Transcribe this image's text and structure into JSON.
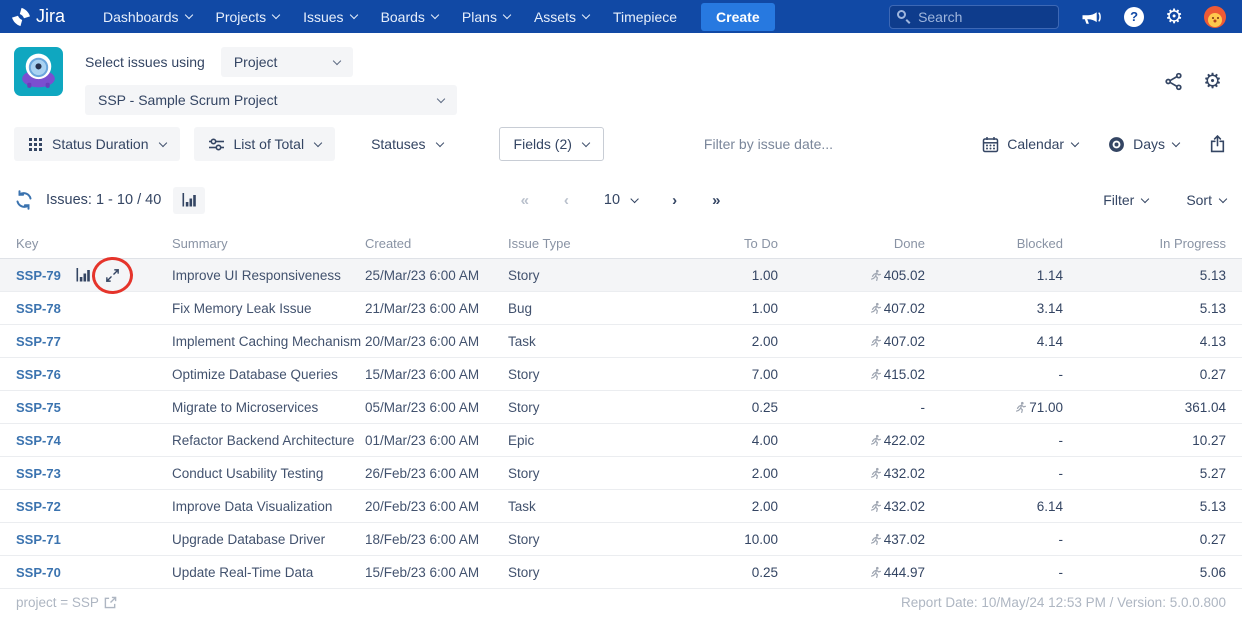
{
  "colors": {
    "nav_bg": "#1149A5",
    "create_bg": "#2779E0",
    "link_blue": "#3B73AF",
    "text_navy": "#344563",
    "muted_gray": "#8993A4",
    "row_highlight": "#F4F5F7",
    "annotation_red": "#E5342B",
    "app_icon_teal": "#0FA7C0"
  },
  "nav": {
    "brand": "Jira",
    "items": [
      {
        "label": "Dashboards",
        "caret": true
      },
      {
        "label": "Projects",
        "caret": true
      },
      {
        "label": "Issues",
        "caret": true
      },
      {
        "label": "Boards",
        "caret": true
      },
      {
        "label": "Plans",
        "caret": true
      },
      {
        "label": "Assets",
        "caret": true
      },
      {
        "label": "Timepiece",
        "caret": false
      }
    ],
    "create_label": "Create",
    "search_placeholder": "Search"
  },
  "header": {
    "select_label": "Select issues using",
    "source_value": "Project",
    "project_value": "SSP - Sample Scrum Project"
  },
  "toolbar": {
    "report_type": "Status Duration",
    "view": "List of Total",
    "statuses": "Statuses",
    "fields": "Fields (2)",
    "date_filter_placeholder": "Filter by issue date...",
    "calendar": "Calendar",
    "unit": "Days"
  },
  "issues_bar": {
    "count_text": "Issues: 1 - 10 / 40",
    "pagination": {
      "first": "«",
      "prev": "‹",
      "page_size": "10",
      "next": "›",
      "last": "»"
    },
    "filter": "Filter",
    "sort": "Sort"
  },
  "table": {
    "columns": [
      {
        "label": "Key",
        "align": "left"
      },
      {
        "label": "Summary",
        "align": "left"
      },
      {
        "label": "Created",
        "align": "left"
      },
      {
        "label": "Issue Type",
        "align": "left"
      },
      {
        "label": "To Do",
        "align": "right"
      },
      {
        "label": "Done",
        "align": "right"
      },
      {
        "label": "Blocked",
        "align": "right"
      },
      {
        "label": "In Progress",
        "align": "right"
      }
    ],
    "rows": [
      {
        "key": "SSP-79",
        "summary": "Improve UI Responsiveness",
        "created": "25/Mar/23 6:00 AM",
        "issue_type": "Story",
        "to_do": "1.00",
        "done": "405.02",
        "done_icon": true,
        "blocked": "1.14",
        "blocked_icon": false,
        "in_progress": "5.13",
        "show_icons": true,
        "highlight": true,
        "annotated": true
      },
      {
        "key": "SSP-78",
        "summary": "Fix Memory Leak Issue",
        "created": "21/Mar/23 6:00 AM",
        "issue_type": "Bug",
        "to_do": "1.00",
        "done": "407.02",
        "done_icon": true,
        "blocked": "3.14",
        "blocked_icon": false,
        "in_progress": "5.13",
        "show_icons": false,
        "highlight": false,
        "annotated": false
      },
      {
        "key": "SSP-77",
        "summary": "Implement Caching Mechanism",
        "created": "20/Mar/23 6:00 AM",
        "issue_type": "Task",
        "to_do": "2.00",
        "done": "407.02",
        "done_icon": true,
        "blocked": "4.14",
        "blocked_icon": false,
        "in_progress": "4.13",
        "show_icons": false,
        "highlight": false,
        "annotated": false
      },
      {
        "key": "SSP-76",
        "summary": "Optimize Database Queries",
        "created": "15/Mar/23 6:00 AM",
        "issue_type": "Story",
        "to_do": "7.00",
        "done": "415.02",
        "done_icon": true,
        "blocked": "-",
        "blocked_icon": false,
        "in_progress": "0.27",
        "show_icons": false,
        "highlight": false,
        "annotated": false
      },
      {
        "key": "SSP-75",
        "summary": "Migrate to Microservices",
        "created": "05/Mar/23 6:00 AM",
        "issue_type": "Story",
        "to_do": "0.25",
        "done": "-",
        "done_icon": false,
        "blocked": "71.00",
        "blocked_icon": true,
        "in_progress": "361.04",
        "show_icons": false,
        "highlight": false,
        "annotated": false
      },
      {
        "key": "SSP-74",
        "summary": "Refactor Backend Architecture",
        "created": "01/Mar/23 6:00 AM",
        "issue_type": "Epic",
        "to_do": "4.00",
        "done": "422.02",
        "done_icon": true,
        "blocked": "-",
        "blocked_icon": false,
        "in_progress": "10.27",
        "show_icons": false,
        "highlight": false,
        "annotated": false
      },
      {
        "key": "SSP-73",
        "summary": "Conduct Usability Testing",
        "created": "26/Feb/23 6:00 AM",
        "issue_type": "Story",
        "to_do": "2.00",
        "done": "432.02",
        "done_icon": true,
        "blocked": "-",
        "blocked_icon": false,
        "in_progress": "5.27",
        "show_icons": false,
        "highlight": false,
        "annotated": false
      },
      {
        "key": "SSP-72",
        "summary": "Improve Data Visualization",
        "created": "20/Feb/23 6:00 AM",
        "issue_type": "Task",
        "to_do": "2.00",
        "done": "432.02",
        "done_icon": true,
        "blocked": "6.14",
        "blocked_icon": false,
        "in_progress": "5.13",
        "show_icons": false,
        "highlight": false,
        "annotated": false
      },
      {
        "key": "SSP-71",
        "summary": "Upgrade Database Driver",
        "created": "18/Feb/23 6:00 AM",
        "issue_type": "Story",
        "to_do": "10.00",
        "done": "437.02",
        "done_icon": true,
        "blocked": "-",
        "blocked_icon": false,
        "in_progress": "0.27",
        "show_icons": false,
        "highlight": false,
        "annotated": false
      },
      {
        "key": "SSP-70",
        "summary": "Update Real-Time Data",
        "created": "15/Feb/23 6:00 AM",
        "issue_type": "Story",
        "to_do": "0.25",
        "done": "444.97",
        "done_icon": true,
        "blocked": "-",
        "blocked_icon": false,
        "in_progress": "5.06",
        "show_icons": false,
        "highlight": false,
        "annotated": false
      }
    ]
  },
  "footer": {
    "left": "project = SSP",
    "right": "Report Date: 10/May/24 12:53 PM / Version: 5.0.0.800"
  },
  "icons": {
    "nav": [
      "jira-logo",
      "search-icon",
      "megaphone-icon",
      "help-icon",
      "gear-icon",
      "avatar"
    ],
    "header": [
      "app-logo-icon",
      "share-icon",
      "gear-icon"
    ],
    "toolbar": [
      "grid-icon",
      "sliders-icon",
      "calendar-icon",
      "record-circle-icon",
      "export-icon"
    ],
    "issues_bar": [
      "refresh-icon",
      "bar-chart-icon"
    ],
    "row": [
      "bar-chart-icon",
      "expand-icon",
      "runner-icon",
      "red-circle-annotation"
    ],
    "footer": [
      "external-link-icon"
    ]
  }
}
